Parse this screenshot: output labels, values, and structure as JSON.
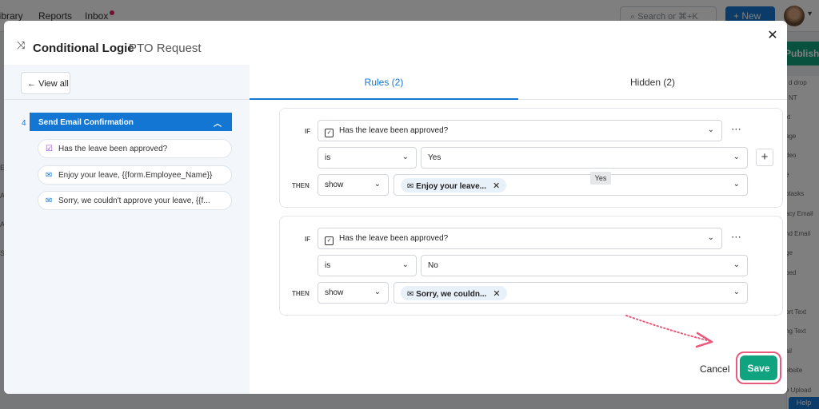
{
  "background": {
    "nav": [
      "Library",
      "Reports",
      "Inbox"
    ],
    "search_placeholder": "Search or ⌘+K",
    "new_button": "New",
    "publish_button": "Publish",
    "right_panel_items": [
      "d drop",
      "NT",
      "xt",
      "age",
      "deo",
      "e",
      "btasks",
      "acy Email",
      "nd Email",
      "ge",
      "bed",
      "ort Text",
      "ng Text",
      "ail",
      "ebsite",
      "e Upload"
    ],
    "left_letters": [
      "E",
      "A",
      "A",
      "S"
    ],
    "help_button": "Help"
  },
  "modal": {
    "title": "Conditional Logic",
    "subtitle": "PTO Request",
    "close_icon": "close-icon"
  },
  "sidebar": {
    "view_all": "View all",
    "step_number": "4",
    "step_title": "Send Email Confirmation",
    "items": [
      {
        "label": "Has the leave been approved?",
        "icon": "checkbox-icon"
      },
      {
        "label": "Enjoy your leave, {{form.Employee_Name}}",
        "icon": "mail-icon"
      },
      {
        "label": "Sorry, we couldn't approve your leave, {{f...",
        "icon": "mail-icon"
      }
    ]
  },
  "tabs": [
    {
      "label": "Rules (2)",
      "active": true
    },
    {
      "label": "Hidden (2)",
      "active": false
    }
  ],
  "rules": [
    {
      "if_label": "IF",
      "question": "Has the leave been approved?",
      "operator": "is",
      "value": "Yes",
      "then_label": "THEN",
      "action": "show",
      "target": "Enjoy your leave..."
    },
    {
      "if_label": "IF",
      "question": "Has the leave been approved?",
      "operator": "is",
      "value": "No",
      "then_label": "THEN",
      "action": "show",
      "target": "Sorry, we couldn..."
    }
  ],
  "tooltip": "Yes",
  "footer": {
    "cancel": "Cancel",
    "save": "Save"
  },
  "colors": {
    "primary": "#1476d3",
    "save": "#10a37f",
    "highlight": "#e95b7d"
  }
}
